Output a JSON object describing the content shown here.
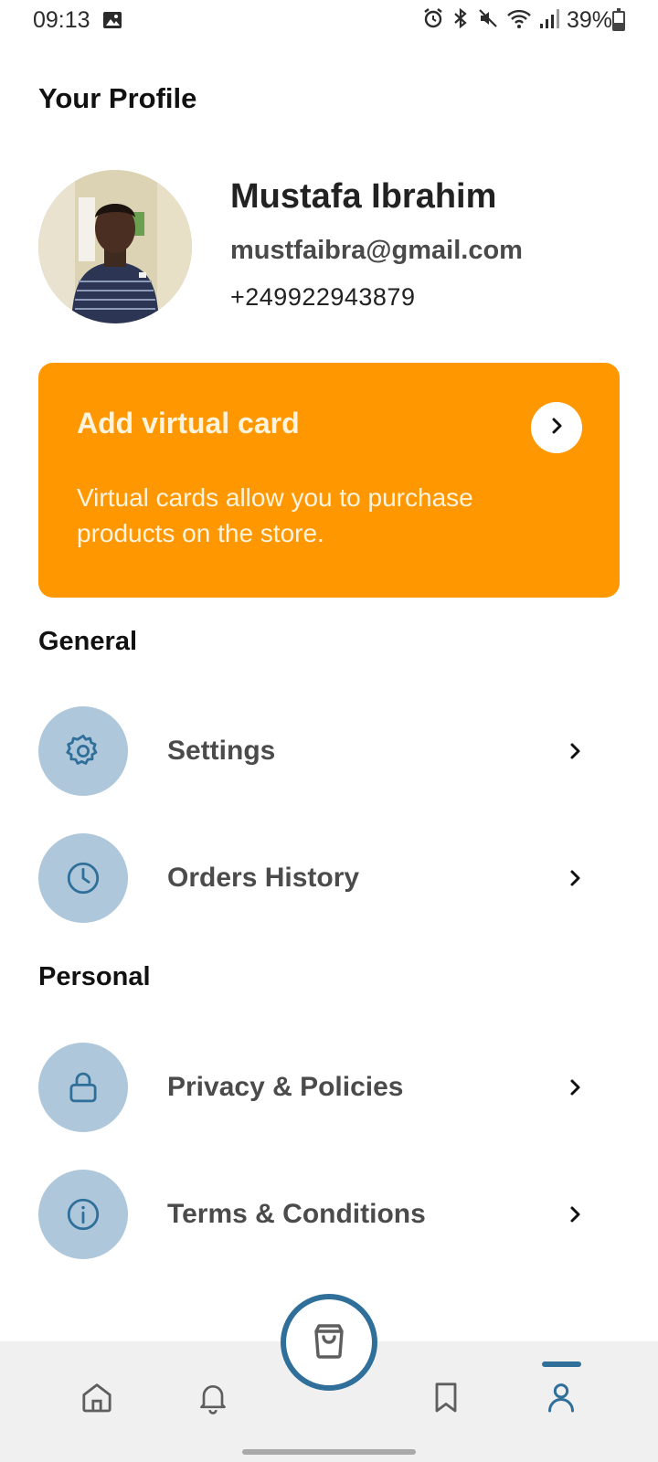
{
  "status_bar": {
    "time": "09:13",
    "battery_percent": "39%",
    "battery_level": 0.39,
    "icons": [
      "gallery-icon",
      "alarm-icon",
      "bluetooth-icon",
      "mute-icon",
      "wifi-icon",
      "signal-icon",
      "battery-icon"
    ]
  },
  "page": {
    "title": "Your Profile"
  },
  "profile": {
    "name": "Mustafa Ibrahim",
    "email": "mustfaibra@gmail.com",
    "phone": "+249922943879"
  },
  "virtual_card": {
    "title": "Add virtual card",
    "description": "Virtual cards allow you to purchase products on the store.",
    "color": "#ff9800"
  },
  "sections": {
    "general": {
      "title": "General",
      "items": [
        {
          "label": "Settings",
          "icon": "gear-icon"
        },
        {
          "label": "Orders History",
          "icon": "clock-icon"
        }
      ]
    },
    "personal": {
      "title": "Personal",
      "items": [
        {
          "label": "Privacy & Policies",
          "icon": "lock-icon"
        },
        {
          "label": "Terms & Conditions",
          "icon": "info-icon"
        }
      ]
    }
  },
  "bottom_nav": {
    "items": [
      "home-icon",
      "bell-icon",
      "cart-icon",
      "bookmark-icon",
      "profile-icon"
    ],
    "active": "profile",
    "accent_color": "#2f6f99"
  }
}
